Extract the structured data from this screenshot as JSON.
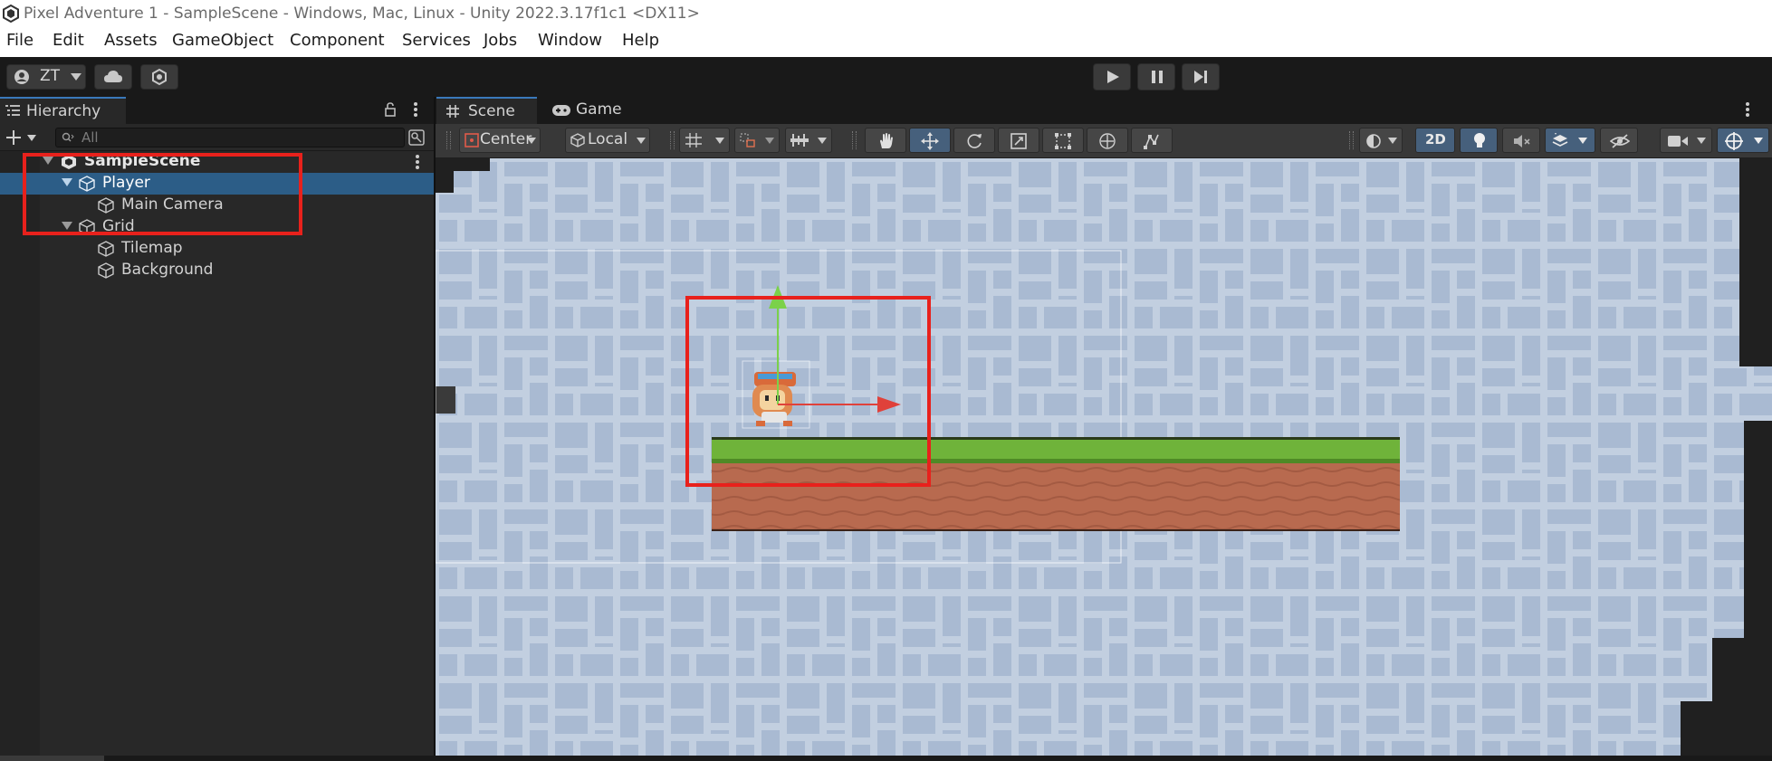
{
  "window": {
    "title": "Pixel Adventure 1 - SampleScene - Windows, Mac, Linux - Unity 2022.3.17f1c1 <DX11>"
  },
  "menu": [
    "File",
    "Edit",
    "Assets",
    "GameObject",
    "Component",
    "Services",
    "Jobs",
    "Window",
    "Help"
  ],
  "toolbar": {
    "account_label": "ZT",
    "icons": [
      "account-icon",
      "cloud-icon",
      "collab-icon",
      "play-icon",
      "pause-icon",
      "step-icon"
    ]
  },
  "hierarchy": {
    "tab_label": "Hierarchy",
    "search_placeholder": "All",
    "items": [
      {
        "label": "SampleScene",
        "depth": 0,
        "type": "scene",
        "expanded": true,
        "selected": false
      },
      {
        "label": "Player",
        "depth": 1,
        "type": "gameobject",
        "expanded": true,
        "selected": true
      },
      {
        "label": "Main Camera",
        "depth": 2,
        "type": "gameobject",
        "selected": false
      },
      {
        "label": "Grid",
        "depth": 1,
        "type": "gameobject",
        "expanded": true,
        "selected": false
      },
      {
        "label": "Tilemap",
        "depth": 2,
        "type": "gameobject",
        "selected": false
      },
      {
        "label": "Background",
        "depth": 2,
        "type": "gameobject",
        "selected": false
      }
    ]
  },
  "scene": {
    "tabs": [
      {
        "label": "Scene",
        "icon": "grid-hash-icon",
        "active": true
      },
      {
        "label": "Game",
        "icon": "gamepad-icon",
        "active": false
      }
    ],
    "pivot_label": "Center",
    "space_label": "Local",
    "mode_2d_label": "2D",
    "mode_2d_active": true,
    "active_tool": "move"
  },
  "colors": {
    "accent": "#3a79bb",
    "selection": "#2c5d87",
    "highlight_box": "#e8211c",
    "scene_bg": "#c2cfe0",
    "scene_tile": "#a9bad2",
    "grass": "#6fb33a",
    "dirt": "#b86a4f"
  }
}
